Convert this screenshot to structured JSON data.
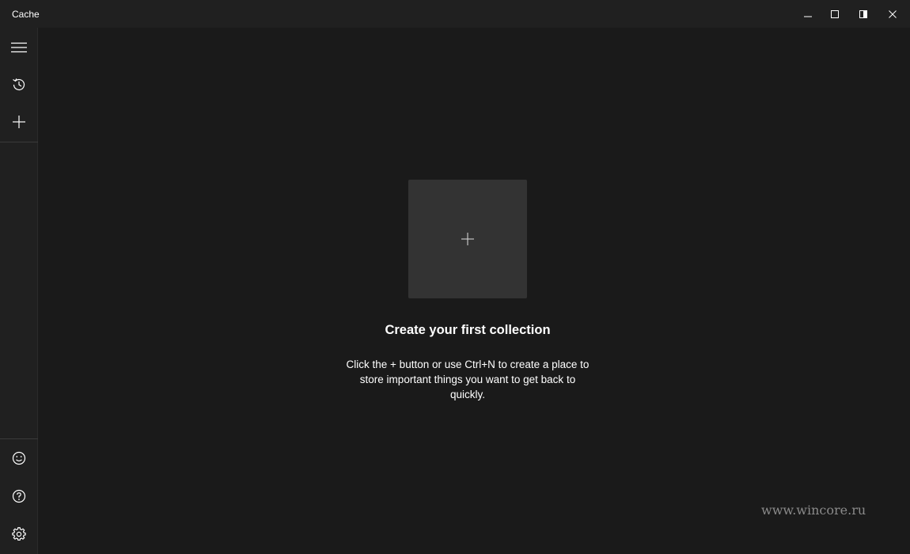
{
  "window": {
    "title": "Cache"
  },
  "caption_buttons": {
    "minimize": "minimize-icon",
    "maximize": "maximize-icon",
    "snap": "snap-layout-icon",
    "close": "close-icon"
  },
  "sidebar": {
    "top_items": [
      {
        "icon": "hamburger-menu-icon"
      },
      {
        "icon": "history-icon"
      },
      {
        "icon": "add-icon"
      }
    ],
    "bottom_items": [
      {
        "icon": "feedback-smiley-icon"
      },
      {
        "icon": "help-icon"
      },
      {
        "icon": "settings-gear-icon"
      }
    ]
  },
  "main": {
    "add_tile_icon": "plus-icon",
    "empty_state_title": "Create your first collection",
    "empty_state_description": "Click the + button or use Ctrl+N to create a place to store important things you want to get back to quickly."
  },
  "watermark": "www.wincore.ru",
  "colors": {
    "background": "#1a1a1a",
    "sidebar": "#202020",
    "tile": "#333333",
    "text": "#ffffff"
  }
}
